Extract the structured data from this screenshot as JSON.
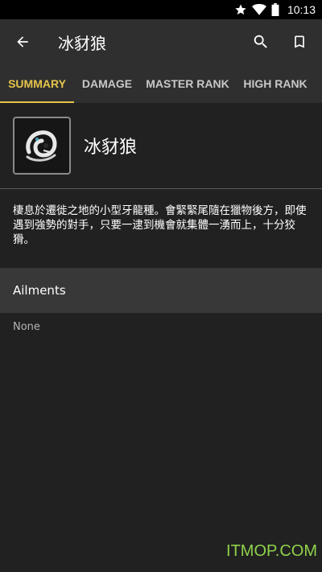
{
  "status_bar": {
    "time": "10:13"
  },
  "app_bar": {
    "title": "冰豺狼",
    "icons": [
      "back-arrow-icon",
      "search-icon",
      "bookmark-icon"
    ]
  },
  "tabs": [
    {
      "label": "SUMMARY",
      "active": true
    },
    {
      "label": "DAMAGE",
      "active": false
    },
    {
      "label": "MASTER RANK",
      "active": false
    },
    {
      "label": "HIGH RANK",
      "active": false
    }
  ],
  "monster": {
    "name": "冰豺狼",
    "description": "棲息於遷徙之地的小型牙龍種。會緊緊尾隨在獵物後方，即使遇到強勢的對手，只要一逮到機會就集體一湧而上，十分狡猾。"
  },
  "ailments": {
    "header": "Ailments",
    "value": "None"
  },
  "watermark": "ITMOP.COM",
  "colors": {
    "accent": "#e5c44b",
    "app_bar": "#2f2f2f",
    "background": "#212121",
    "section": "#383838"
  }
}
